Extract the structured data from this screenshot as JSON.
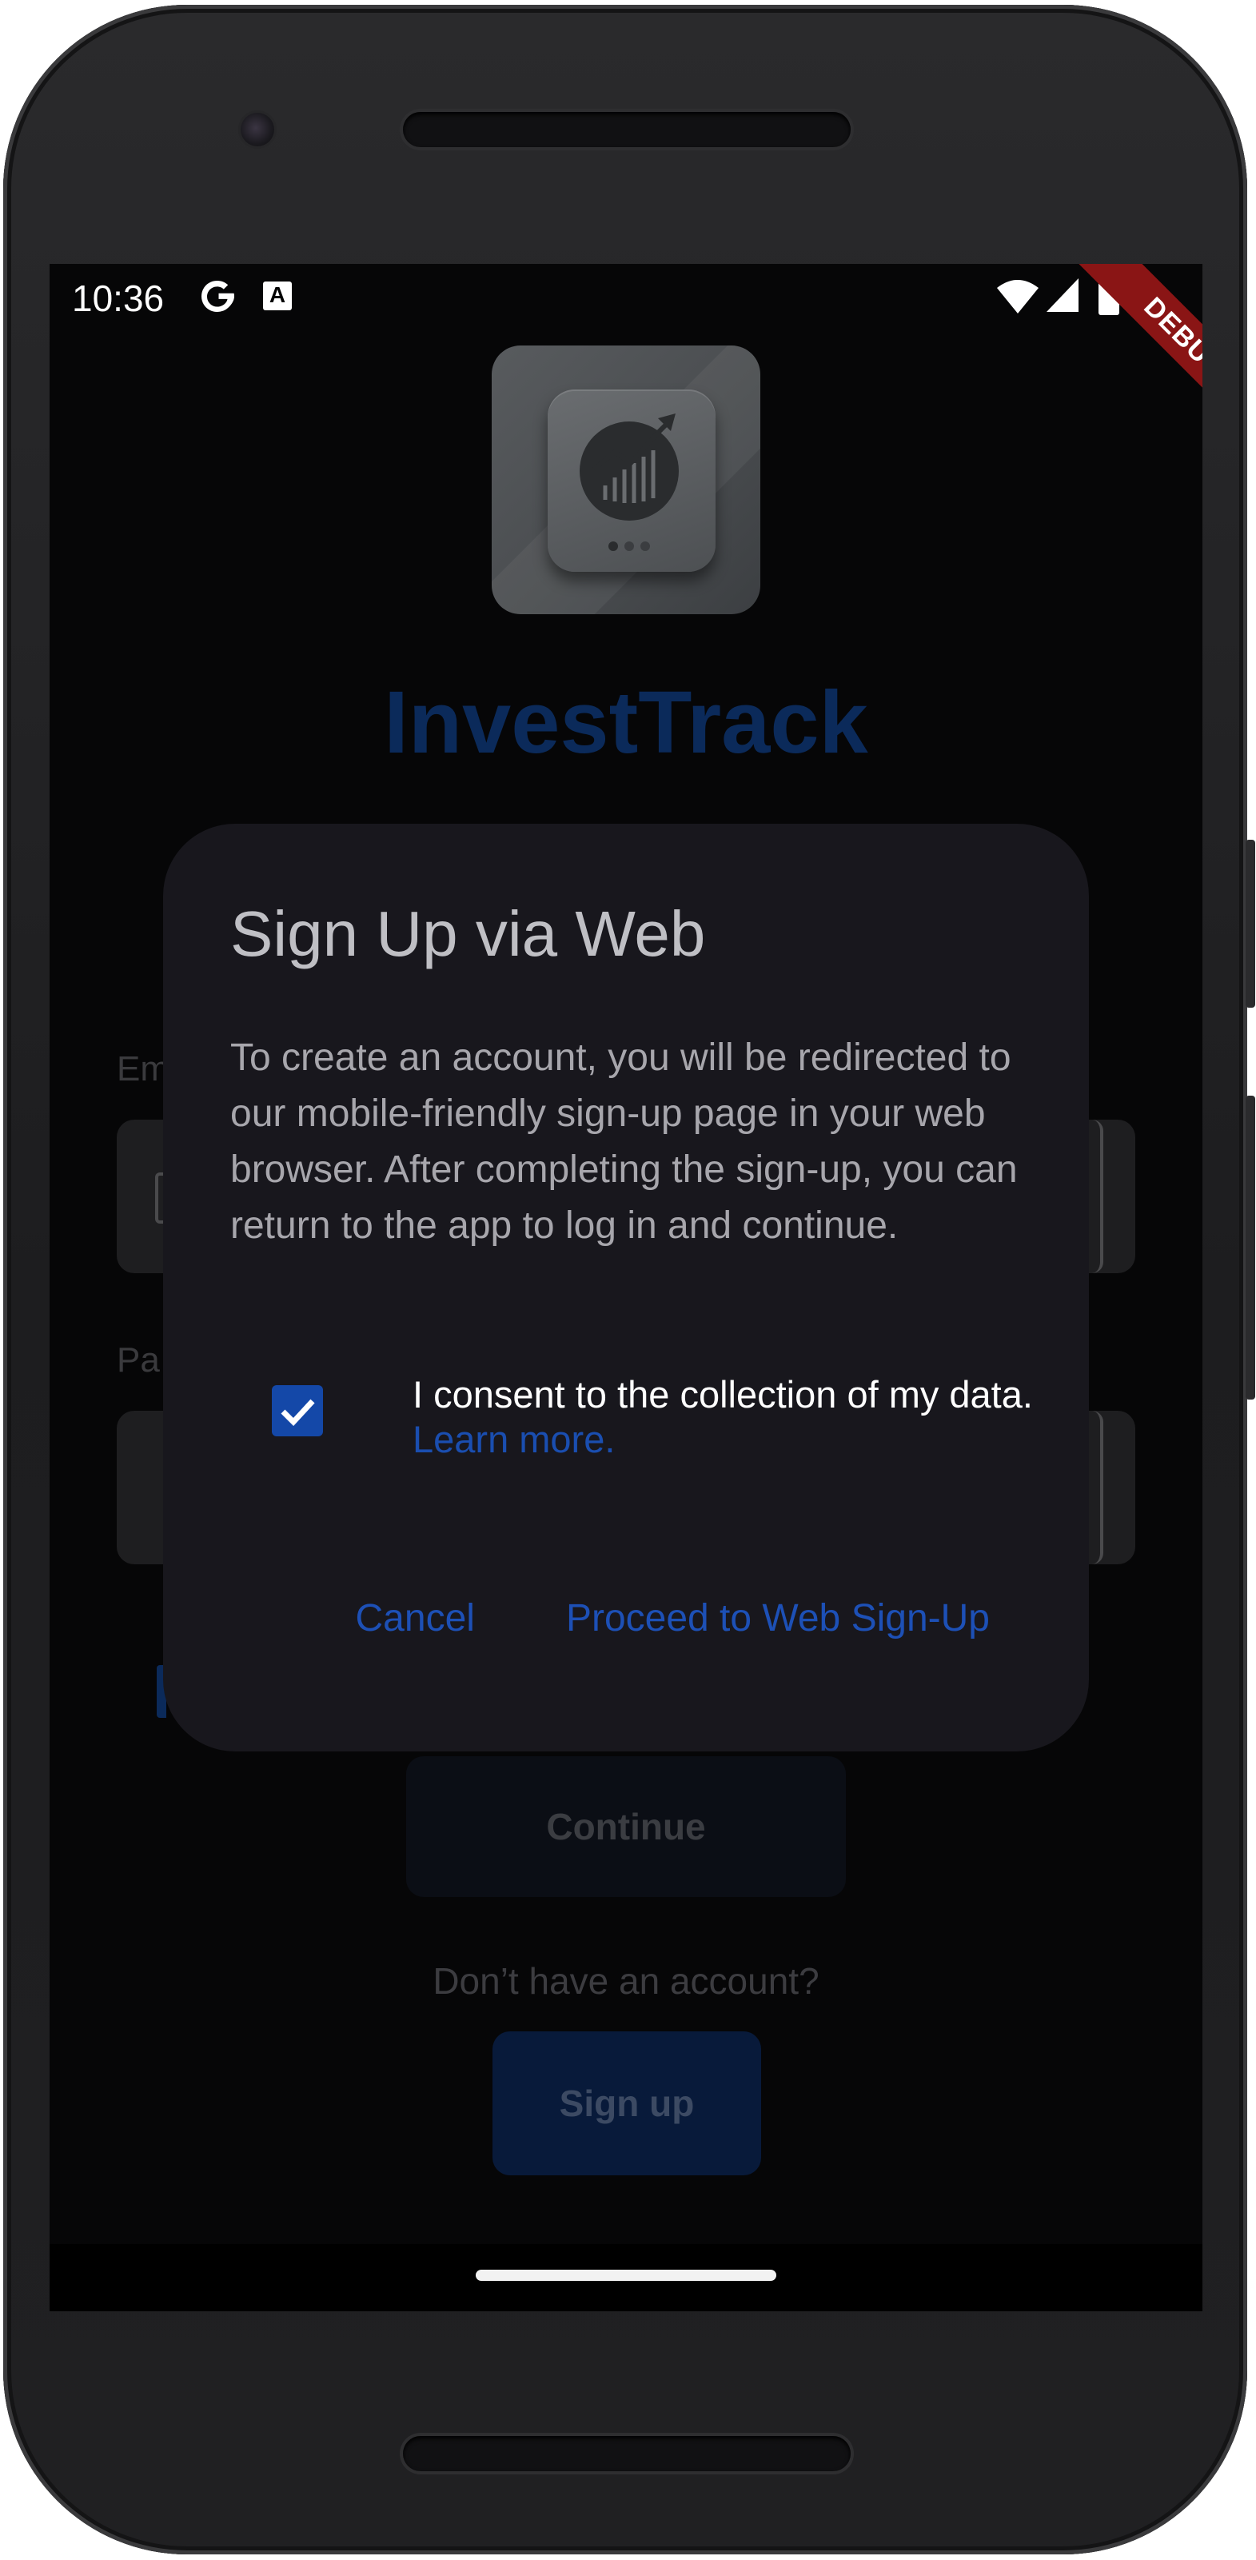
{
  "status_bar": {
    "time": "10:36",
    "icons": [
      "google-icon",
      "a-notification-icon",
      "wifi-icon",
      "cellular-icon",
      "battery-icon"
    ]
  },
  "debug_banner": "DEBUG",
  "login_page": {
    "app_name": "InvestTrack",
    "email_label": "Em",
    "password_label": "Pa",
    "continue_label": "Continue",
    "no_account_text": "Don’t have an account?",
    "signup_label": "Sign up"
  },
  "dialog": {
    "title": "Sign Up via Web",
    "body": "To create an account, you will be redirected to our mobile-friendly sign-up page in your web browser. After completing the sign-up, you can return to the app to log in and continue.",
    "consent_text": "I consent to the collection of my data.",
    "consent_link": "Learn more.",
    "consent_checked": true,
    "cancel_label": "Cancel",
    "proceed_label": "Proceed to Web Sign-Up"
  },
  "colors": {
    "accent": "#1d50b6",
    "checkbox": "#1448a8",
    "dialog_bg": "#18171d",
    "debug_banner": "#8a1515"
  }
}
